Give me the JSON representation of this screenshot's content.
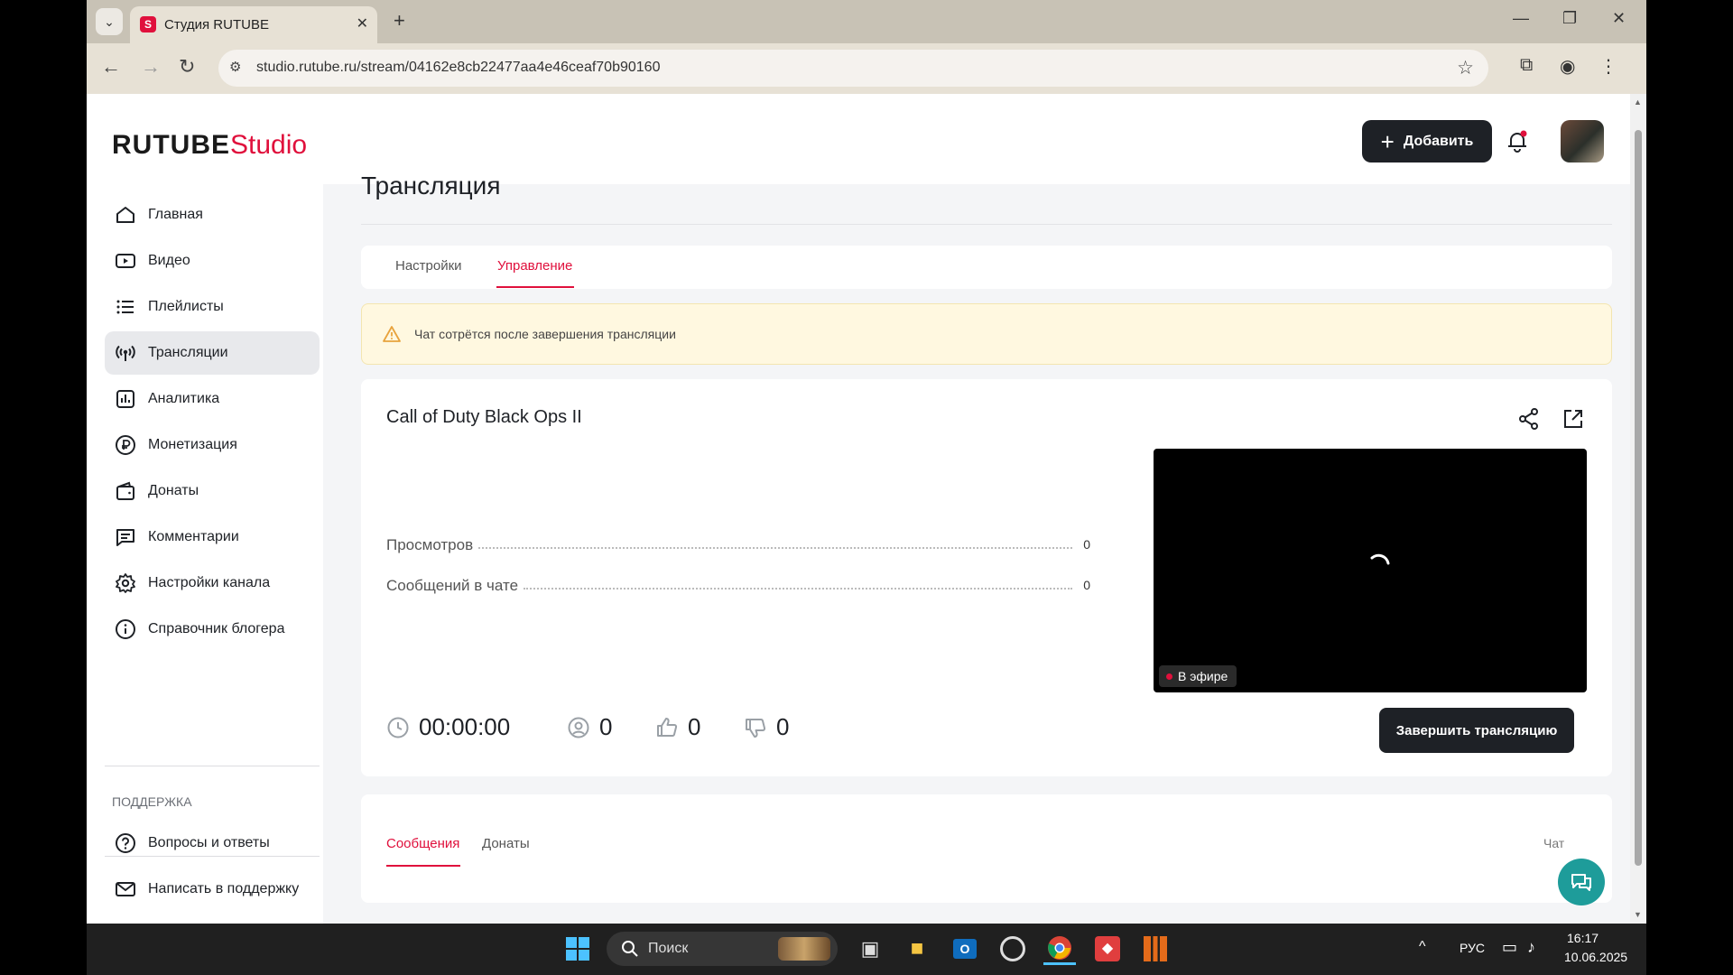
{
  "browser": {
    "tab_title": "Студия RUTUBE",
    "url": "studio.rutube.ru/stream/04162e8cb22477aa4e46ceaf70b90160"
  },
  "header": {
    "logo_main": "RUTUBE",
    "logo_studio": "Studio",
    "add_label": "Добавить"
  },
  "sidebar": {
    "items": [
      {
        "label": "Главная",
        "icon": "home-icon"
      },
      {
        "label": "Видео",
        "icon": "video-icon"
      },
      {
        "label": "Плейлисты",
        "icon": "list-icon"
      },
      {
        "label": "Трансляции",
        "icon": "broadcast-icon",
        "active": true
      },
      {
        "label": "Аналитика",
        "icon": "analytics-icon"
      },
      {
        "label": "Монетизация",
        "icon": "ruble-icon"
      },
      {
        "label": "Донаты",
        "icon": "wallet-icon"
      },
      {
        "label": "Комментарии",
        "icon": "comment-icon"
      },
      {
        "label": "Настройки канала",
        "icon": "gear-icon"
      },
      {
        "label": "Справочник блогера",
        "icon": "info-icon"
      }
    ],
    "support_heading": "ПОДДЕРЖКА",
    "support_items": [
      {
        "label": "Вопросы и ответы",
        "icon": "question-icon"
      },
      {
        "label": "Написать в поддержку",
        "icon": "mail-icon"
      }
    ]
  },
  "main": {
    "page_title": "Трансляция",
    "tabs": [
      "Настройки",
      "Управление"
    ],
    "active_tab": "Управление",
    "warning": "Чат сотрётся после завершения трансляции",
    "stream": {
      "title": "Call of Duty Black Ops II",
      "stats": [
        {
          "label": "Просмотров",
          "value": "0"
        },
        {
          "label": "Сообщений в чате",
          "value": "0"
        }
      ],
      "live_label": "В эфире",
      "duration": "00:00:00",
      "viewers": "0",
      "likes": "0",
      "dislikes": "0",
      "end_button": "Завершить трансляцию"
    },
    "chat": {
      "tabs": [
        "Сообщения",
        "Донаты"
      ],
      "label": "Чат"
    }
  },
  "taskbar": {
    "search_label": "Поиск",
    "language": "РУС",
    "time": "16:17",
    "date": "10.06.2025"
  },
  "colors": {
    "accent": "#e0103c",
    "dark": "#1e2126",
    "warning_bg": "#fff8e0",
    "help_fab": "#1e9c9a"
  }
}
